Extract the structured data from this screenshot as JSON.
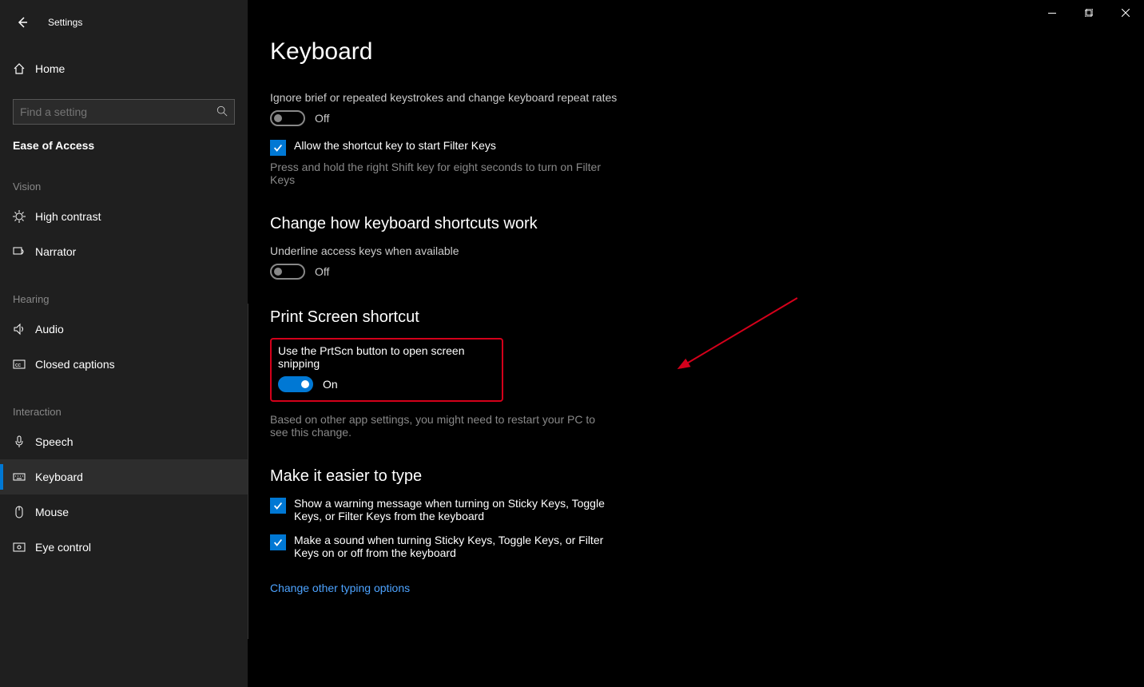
{
  "window": {
    "title": "Settings"
  },
  "sidebar": {
    "home": "Home",
    "search_placeholder": "Find a setting",
    "category": "Ease of Access",
    "sections": {
      "vision": "Vision",
      "hearing": "Hearing",
      "interaction": "Interaction"
    },
    "items": {
      "high_contrast": "High contrast",
      "narrator": "Narrator",
      "audio": "Audio",
      "closed_captions": "Closed captions",
      "speech": "Speech",
      "keyboard": "Keyboard",
      "mouse": "Mouse",
      "eye_control": "Eye control"
    }
  },
  "page": {
    "title": "Keyboard",
    "filter_desc": "Ignore brief or repeated keystrokes and change keyboard repeat rates",
    "filter_state": "Off",
    "filter_check": "Allow the shortcut key to start Filter Keys",
    "filter_hint": "Press and hold the right Shift key for eight seconds to turn on Filter Keys",
    "shortcuts_heading": "Change how keyboard shortcuts work",
    "underline_desc": "Underline access keys when available",
    "underline_state": "Off",
    "prtscn_heading": "Print Screen shortcut",
    "prtscn_desc": "Use the PrtScn button to open screen snipping",
    "prtscn_state": "On",
    "prtscn_hint": "Based on other app settings, you might need to restart your PC to see this change.",
    "type_heading": "Make it easier to type",
    "type_check1": "Show a warning message when turning on Sticky Keys, Toggle Keys, or Filter Keys from the keyboard",
    "type_check2": "Make a sound when turning Sticky Keys, Toggle Keys, or Filter Keys on or off from the keyboard",
    "type_link": "Change other typing options"
  }
}
